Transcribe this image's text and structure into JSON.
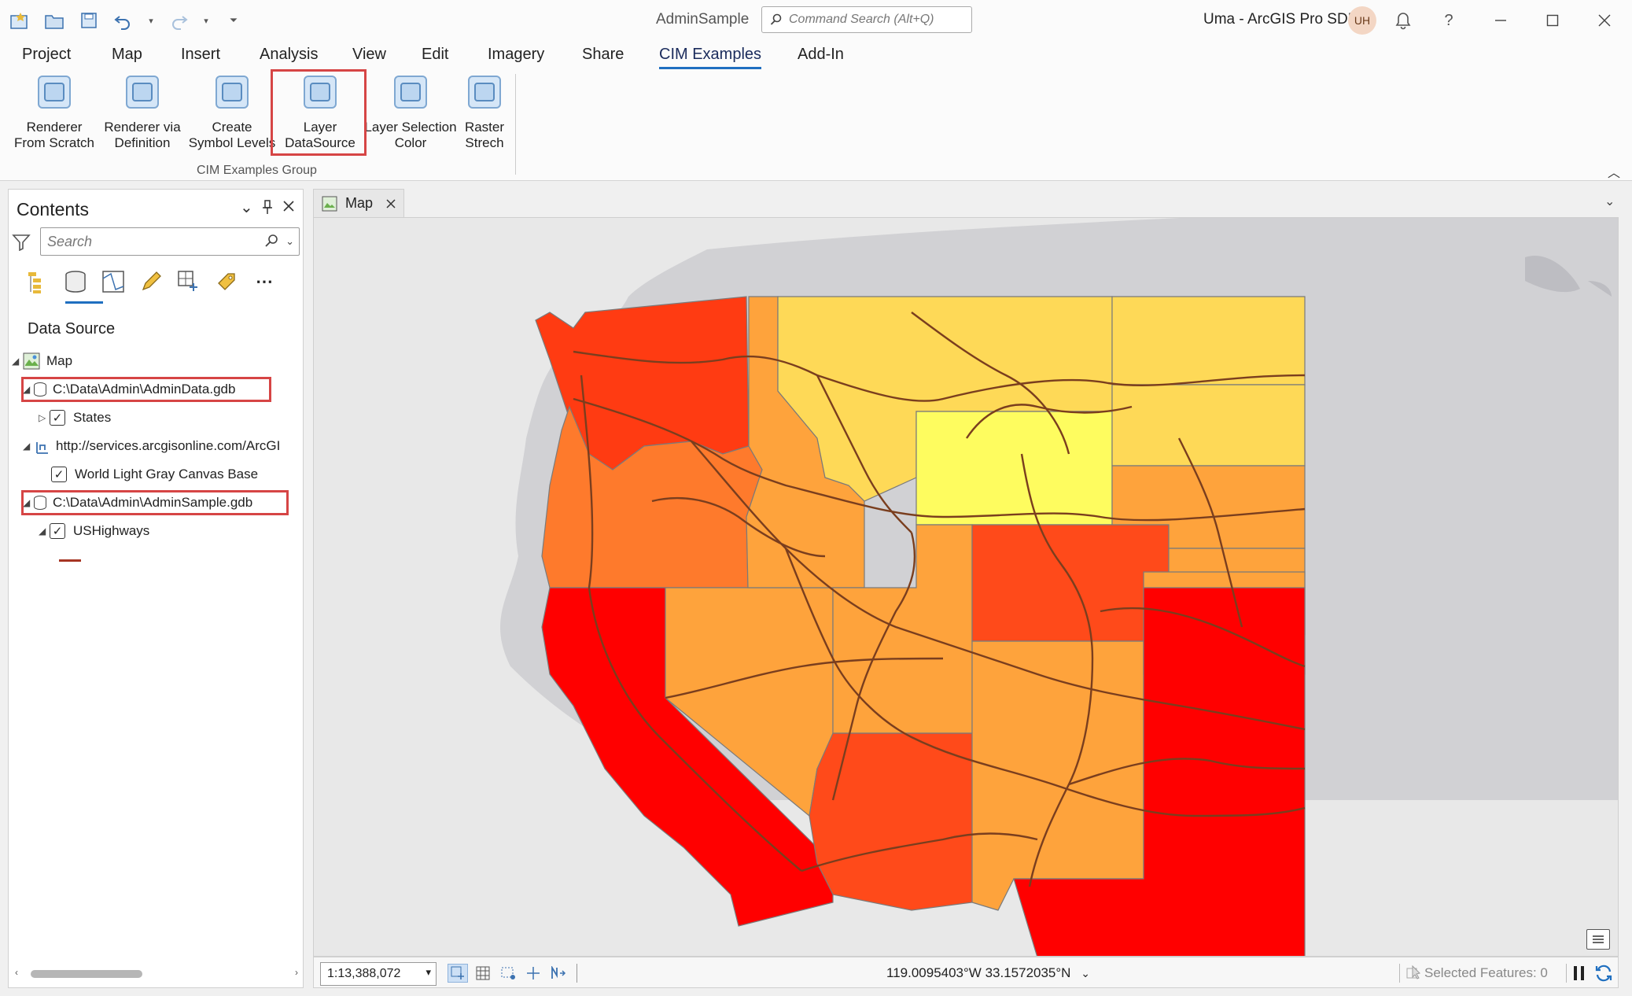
{
  "window": {
    "title": "AdminSample",
    "user": "Uma - ArcGIS Pro SDK",
    "avatar_initials": "UH"
  },
  "command_search": {
    "placeholder": "Command Search (Alt+Q)"
  },
  "ribbon_tabs": [
    "Project",
    "Map",
    "Insert",
    "Analysis",
    "View",
    "Edit",
    "Imagery",
    "Share",
    "CIM Examples",
    "Add-In"
  ],
  "active_tab": "CIM Examples",
  "ribbon": {
    "buttons": [
      {
        "label": "Renderer\nFrom Scratch"
      },
      {
        "label": "Renderer via\nDefinition"
      },
      {
        "label": "Create\nSymbol Levels"
      },
      {
        "label": "Layer\nDataSource"
      },
      {
        "label": "Layer Selection\nColor"
      },
      {
        "label": "Raster\nStrech"
      }
    ],
    "group_label": "CIM Examples Group"
  },
  "contents": {
    "title": "Contents",
    "search_placeholder": "Search",
    "section_heading": "Data Source",
    "tree": {
      "map": "Map",
      "gdb1": "C:\\Data\\Admin\\AdminData.gdb",
      "states": "States",
      "service": "http://services.arcgisonline.com/ArcGI",
      "basemap": "World Light Gray Canvas Base",
      "gdb2": "C:\\Data\\Admin\\AdminSample.gdb",
      "highways": "USHighways"
    }
  },
  "map_view": {
    "tab_label": "Map",
    "scale": "1:13,388,072",
    "coordinates": "119.0095403°W 33.1572035°N",
    "selected_features": "Selected Features: 0"
  },
  "colors": {
    "accent": "#1f6fc0",
    "highlight_box": "#d64545",
    "highway_line": "#7a3e1e",
    "land_gray": "#cfcfd2",
    "ocean": "#e8e8e8",
    "state_fills": [
      "#ff0000",
      "#ff4a1a",
      "#fe7a2c",
      "#fea33c",
      "#fec24a",
      "#fed957",
      "#fefc5f"
    ]
  }
}
